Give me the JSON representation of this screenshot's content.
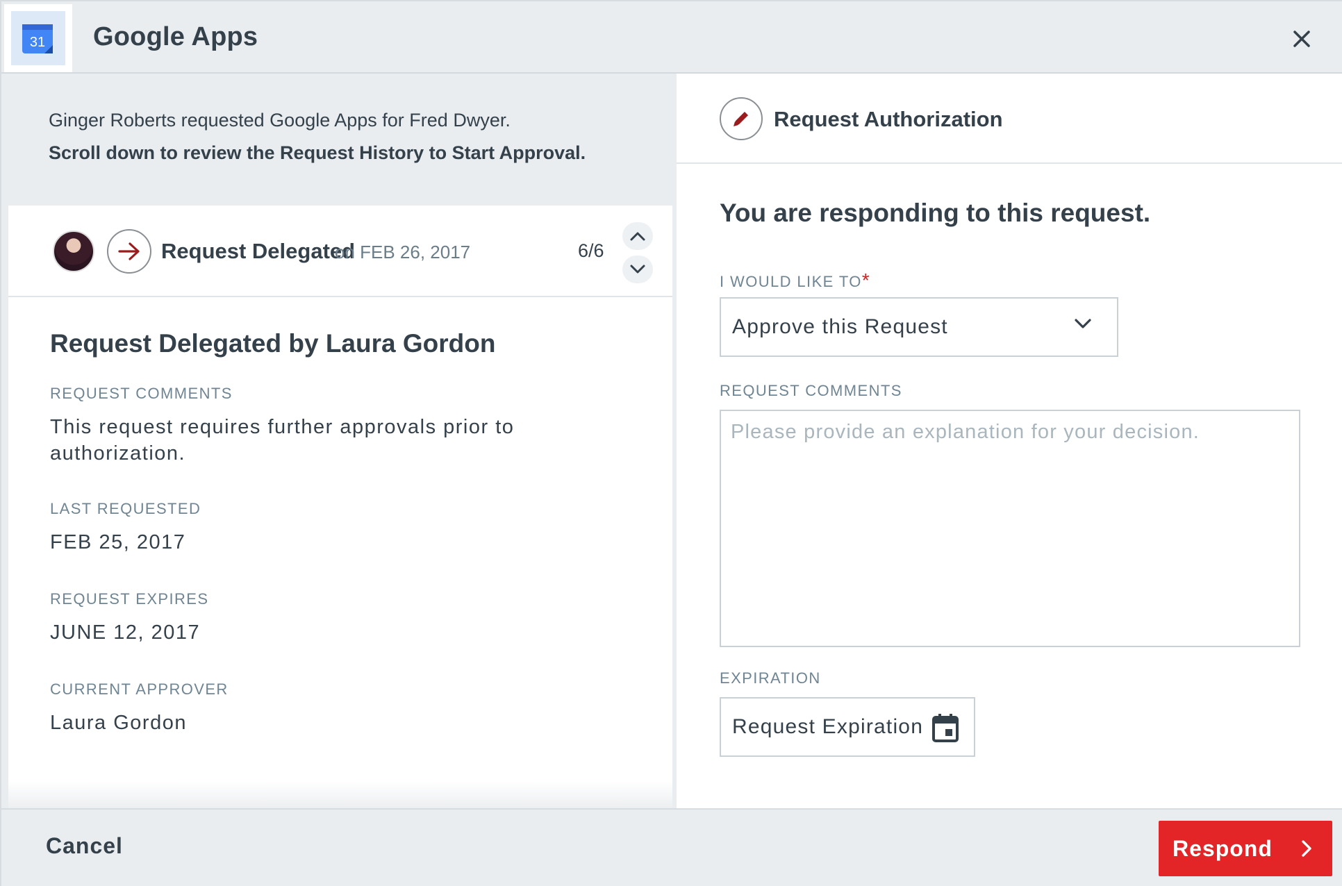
{
  "header": {
    "app_title": "Google Apps",
    "app_icon": "google-calendar-icon",
    "app_icon_text": "31",
    "close_icon": "close-icon"
  },
  "intro": {
    "line1": "Ginger Roberts requested Google Apps for Fred Dwyer.",
    "line2": "Scroll down to review the Request History to Start Approval."
  },
  "history": {
    "event_title": "Request Delegated",
    "event_date": "on FEB 26, 2017",
    "counter": "6/6",
    "detail_title": "Request Delegated by Laura Gordon",
    "fields": [
      {
        "label": "REQUEST COMMENTS",
        "value": "This request requires further approvals prior to authorization."
      },
      {
        "label": "LAST REQUESTED",
        "value": "FEB 25, 2017"
      },
      {
        "label": "REQUEST EXPIRES",
        "value": "JUNE 12, 2017"
      },
      {
        "label": "CURRENT APPROVER",
        "value": "Laura Gordon"
      }
    ]
  },
  "authorization": {
    "section_title": "Request Authorization",
    "heading": "You are responding to this request.",
    "action_label": "I WOULD LIKE TO",
    "required_mark": "*",
    "action_selected": "Approve this Request",
    "comments_label": "REQUEST COMMENTS",
    "comments_placeholder": "Please provide an explanation for your decision.",
    "expiration_label": "EXPIRATION",
    "expiration_value": "Request Expiration"
  },
  "footer": {
    "cancel_label": "Cancel",
    "respond_label": "Respond"
  },
  "colors": {
    "accent_red": "#e42527",
    "icon_red": "#9b1c1c",
    "text_dark": "#34414b",
    "label_gray": "#6f8593",
    "background": "#e9edf0"
  }
}
